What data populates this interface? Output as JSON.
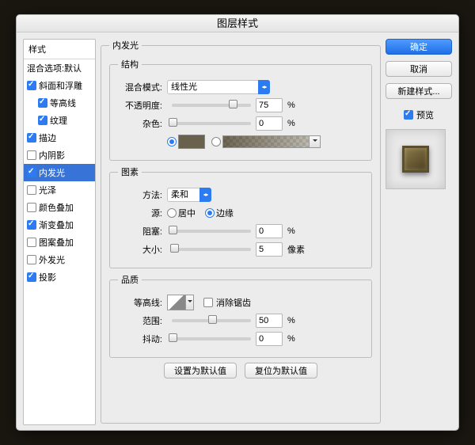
{
  "title": "图层样式",
  "sidebar": {
    "header": "样式",
    "blend_label": "混合选项:默认",
    "items": [
      {
        "label": "斜面和浮雕",
        "on": true,
        "indent": false
      },
      {
        "label": "等高线",
        "on": true,
        "indent": true
      },
      {
        "label": "纹理",
        "on": true,
        "indent": true
      },
      {
        "label": "描边",
        "on": true,
        "indent": false
      },
      {
        "label": "内阴影",
        "on": false,
        "indent": false
      },
      {
        "label": "内发光",
        "on": true,
        "indent": false,
        "selected": true
      },
      {
        "label": "光泽",
        "on": false,
        "indent": false
      },
      {
        "label": "颜色叠加",
        "on": false,
        "indent": false
      },
      {
        "label": "渐变叠加",
        "on": true,
        "indent": false
      },
      {
        "label": "图案叠加",
        "on": false,
        "indent": false
      },
      {
        "label": "外发光",
        "on": false,
        "indent": false
      },
      {
        "label": "投影",
        "on": true,
        "indent": false
      }
    ]
  },
  "panel": {
    "title": "内发光",
    "structure": {
      "legend": "结构",
      "blend_mode_label": "混合模式:",
      "blend_mode_value": "线性光",
      "opacity_label": "不透明度:",
      "opacity_value": "75",
      "opacity_unit": "%",
      "noise_label": "杂色:",
      "noise_value": "0",
      "noise_unit": "%",
      "solid_color": "#6a614d"
    },
    "elements": {
      "legend": "图素",
      "technique_label": "方法:",
      "technique_value": "柔和",
      "source_label": "源:",
      "source_center": "居中",
      "source_edge": "边缘",
      "choke_label": "阻塞:",
      "choke_value": "0",
      "choke_unit": "%",
      "size_label": "大小:",
      "size_value": "5",
      "size_unit": "像素"
    },
    "quality": {
      "legend": "品质",
      "contour_label": "等高线:",
      "antialias_label": "消除锯齿",
      "range_label": "范围:",
      "range_value": "50",
      "range_unit": "%",
      "jitter_label": "抖动:",
      "jitter_value": "0",
      "jitter_unit": "%"
    },
    "reset_default": "设置为默认值",
    "restore_default": "复位为默认值"
  },
  "buttons": {
    "ok": "确定",
    "cancel": "取消",
    "new_style": "新建样式...",
    "preview": "预览"
  }
}
